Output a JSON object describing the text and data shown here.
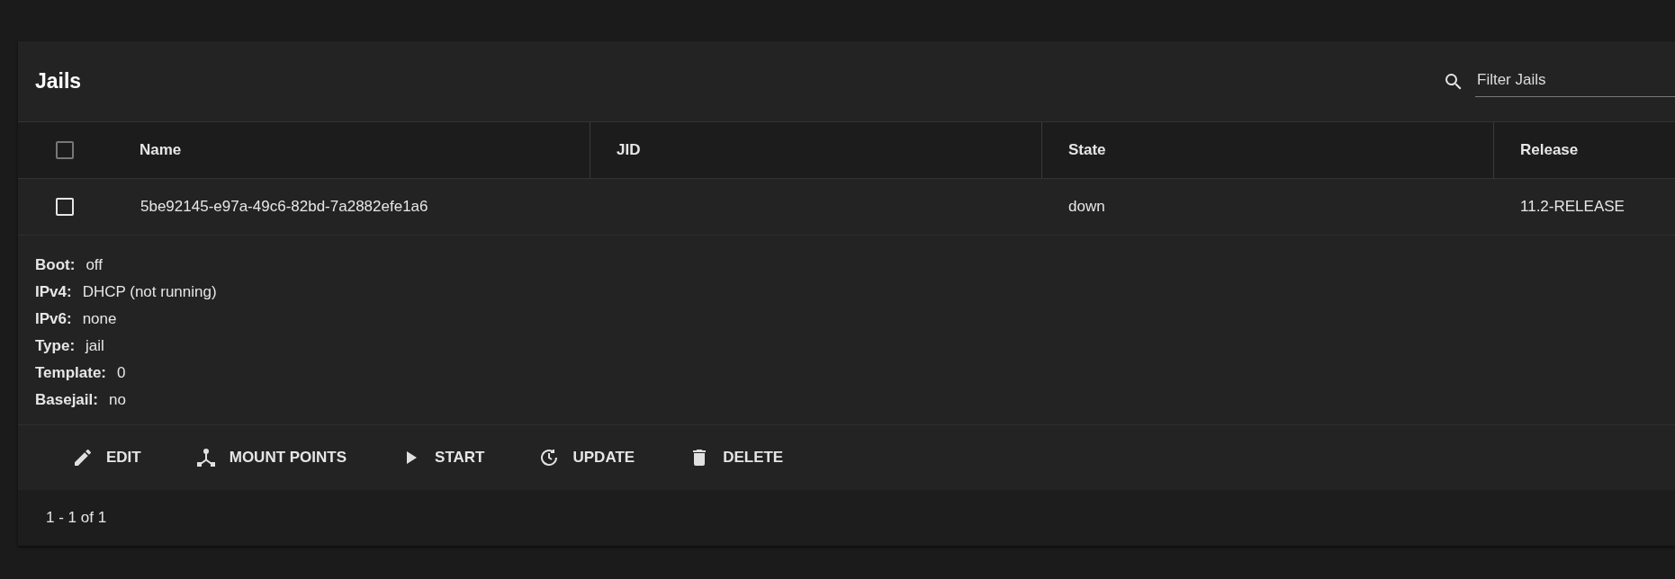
{
  "card": {
    "title": "Jails"
  },
  "search": {
    "placeholder": "Filter Jails"
  },
  "table": {
    "select_all": {
      "checked": false
    },
    "columns": [
      "Name",
      "JID",
      "State",
      "Release"
    ],
    "rows": [
      {
        "checked": false,
        "cells": [
          "5be92145-e97a-49c6-82bd-7a2882efe1a6",
          "",
          "down",
          "11.2-RELEASE"
        ]
      }
    ]
  },
  "details": [
    {
      "label": "Boot:",
      "value": "off"
    },
    {
      "label": "IPv4:",
      "value": "DHCP (not running)"
    },
    {
      "label": "IPv6:",
      "value": "none"
    },
    {
      "label": "Type:",
      "value": "jail"
    },
    {
      "label": "Template:",
      "value": "0"
    },
    {
      "label": "Basejail:",
      "value": "no"
    }
  ],
  "actions": [
    {
      "kind": "edit",
      "label": "EDIT"
    },
    {
      "kind": "mount",
      "label": "MOUNT POINTS"
    },
    {
      "kind": "start",
      "label": "START"
    },
    {
      "kind": "update",
      "label": "UPDATE"
    },
    {
      "kind": "delete",
      "label": "DELETE"
    }
  ],
  "paginator": {
    "range": "1 - 1 of 1"
  }
}
